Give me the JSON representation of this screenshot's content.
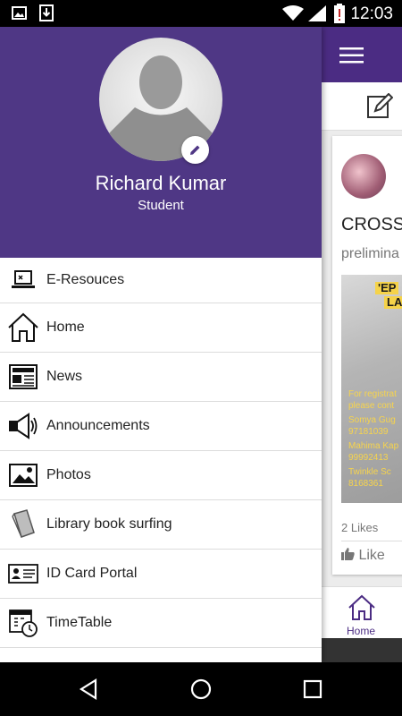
{
  "status_bar": {
    "time": "12:03"
  },
  "drawer": {
    "profile": {
      "name": "Richard Kumar",
      "role": "Student"
    },
    "menu": [
      {
        "label": "E-Resouces",
        "icon": "laptop-icon"
      },
      {
        "label": "Home",
        "icon": "home-icon"
      },
      {
        "label": "News",
        "icon": "newspaper-icon"
      },
      {
        "label": "Announcements",
        "icon": "megaphone-icon"
      },
      {
        "label": "Photos",
        "icon": "photo-icon"
      },
      {
        "label": "Library book surfing",
        "icon": "book-icon"
      },
      {
        "label": "ID Card Portal",
        "icon": "id-card-icon"
      },
      {
        "label": "TimeTable",
        "icon": "calendar-clock-icon"
      }
    ]
  },
  "background": {
    "post_title": "CROSS",
    "post_subtitle": "prelimina",
    "poster_heading": "'EP",
    "poster_heading2": "LA",
    "poster_lines": [
      "For registrat",
      "please cont",
      "Somya Gug",
      "97181039",
      "Mahima Kap",
      "99992413",
      "Twinkle Sc",
      "8168361"
    ],
    "likes": "2 Likes",
    "like_label": "Like",
    "bottom_nav_label": "Home"
  },
  "colors": {
    "header_purple": "#4f3785",
    "appbar_purple": "#4b2c83"
  }
}
